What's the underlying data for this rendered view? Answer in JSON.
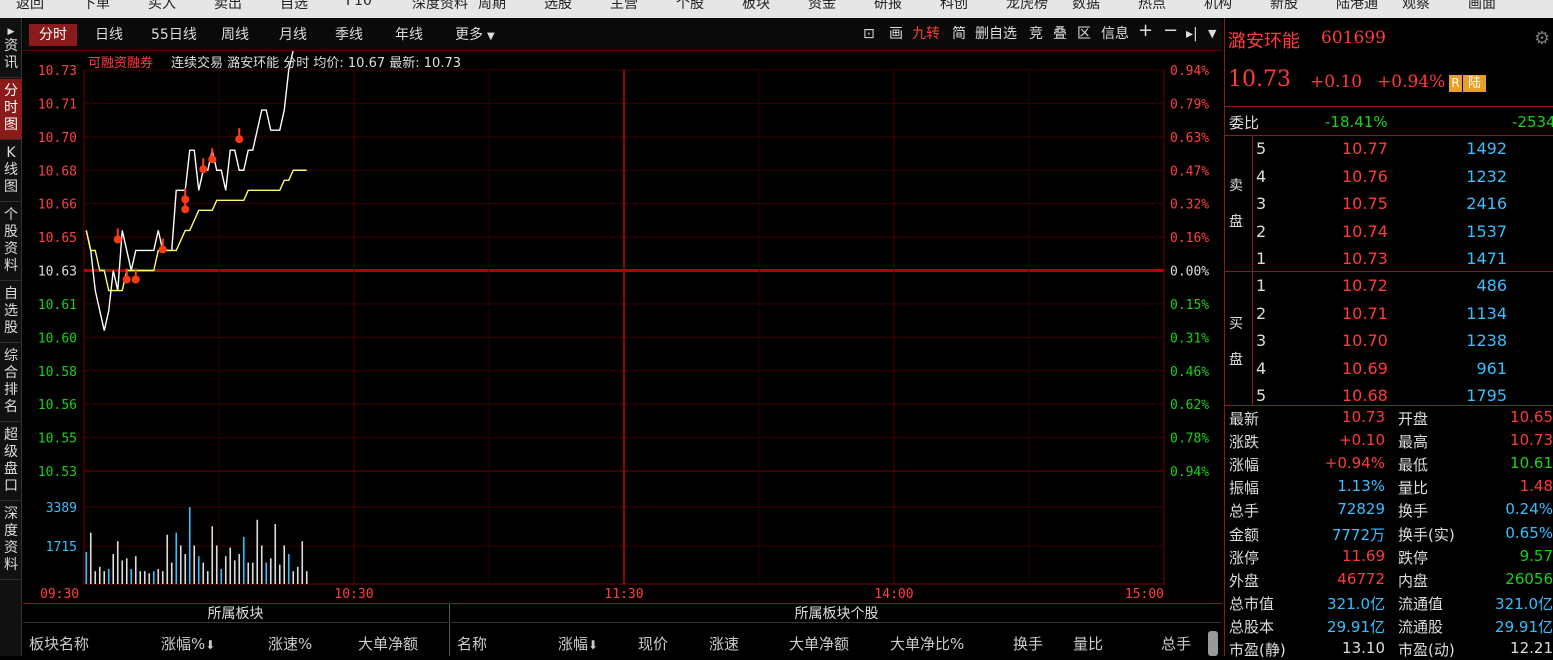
{
  "top_menu": [
    "返回",
    "下单",
    "买入",
    "卖出",
    "自选",
    "F10",
    "深度资料",
    "周期",
    "选股",
    "主营",
    "个股",
    "板块",
    "资金",
    "研报",
    "科创",
    "龙虎榜",
    "数据",
    "热点",
    "机构",
    "新股",
    "陆港通",
    "观察",
    "画面"
  ],
  "sidebar": [
    {
      "label": "资讯",
      "icon": "triangle-right-icon"
    },
    {
      "label": "分时图",
      "active": true
    },
    {
      "label": "K线图"
    },
    {
      "label": "个股资料"
    },
    {
      "label": "自选股"
    },
    {
      "label": "综合排名"
    },
    {
      "label": "超级盘口"
    },
    {
      "label": "深度资料"
    }
  ],
  "period_tabs": [
    "分时",
    "日线",
    "55日线",
    "周线",
    "月线",
    "季线",
    "年线",
    "更多"
  ],
  "tools": {
    "draw": "画",
    "jiuzhuan": "九转",
    "simple": "简",
    "del_watch": "删自选",
    "compete": "竞",
    "overlay": "叠",
    "zone": "区",
    "info": "信息"
  },
  "chart_header": {
    "margin_tag": "可融资融券",
    "text": "连续交易 潞安环能 分时 均价: 10.67 最新: 10.73"
  },
  "chart_data": {
    "type": "line",
    "x": [
      "09:30",
      "09:31",
      "09:32",
      "09:33",
      "09:34",
      "09:35",
      "09:36",
      "09:37",
      "09:38",
      "09:39",
      "09:40",
      "09:41",
      "09:42",
      "09:43",
      "09:44",
      "09:45",
      "09:46",
      "09:47",
      "09:48",
      "09:49",
      "09:50",
      "09:51",
      "09:52",
      "09:53",
      "09:54",
      "09:55",
      "09:56",
      "09:57",
      "09:58",
      "09:59",
      "10:00",
      "10:01",
      "10:02",
      "10:03",
      "10:04",
      "10:05",
      "10:06",
      "10:07",
      "10:08",
      "10:09",
      "10:10",
      "10:11",
      "10:12",
      "10:13",
      "10:14",
      "10:15",
      "10:16",
      "10:17",
      "10:18",
      "10:19",
      "10:20",
      "10:21",
      "10:22",
      "10:23",
      "10:24",
      "10:25",
      "10:26",
      "10:27",
      "10:28",
      "10:29",
      "10:30",
      "10:31"
    ],
    "series": [
      {
        "name": "分时",
        "color": "#ffffff",
        "values": [
          10.65,
          10.64,
          10.62,
          10.61,
          10.6,
          10.61,
          10.63,
          10.62,
          10.65,
          10.64,
          10.63,
          10.64,
          10.64,
          10.64,
          10.64,
          10.64,
          10.65,
          10.64,
          10.64,
          10.64,
          10.67,
          10.67,
          10.67,
          10.69,
          10.69,
          10.67,
          10.68,
          10.68,
          10.69,
          10.68,
          10.68,
          10.67,
          10.69,
          10.69,
          10.68,
          10.68,
          10.69,
          10.69,
          10.7,
          10.71,
          10.71,
          10.7,
          10.7,
          10.7,
          10.71,
          10.73,
          10.74,
          10.75,
          10.75,
          10.75
        ]
      },
      {
        "name": "均价",
        "color": "#ffff66",
        "values": [
          10.65,
          10.64,
          10.64,
          10.63,
          10.63,
          10.62,
          10.62,
          10.62,
          10.62,
          10.63,
          10.63,
          10.63,
          10.63,
          10.63,
          10.63,
          10.63,
          10.64,
          10.64,
          10.64,
          10.64,
          10.64,
          10.645,
          10.65,
          10.65,
          10.655,
          10.66,
          10.66,
          10.66,
          10.66,
          10.665,
          10.665,
          10.665,
          10.665,
          10.665,
          10.665,
          10.665,
          10.67,
          10.67,
          10.67,
          10.67,
          10.67,
          10.67,
          10.67,
          10.67,
          10.675,
          10.675,
          10.68,
          10.68,
          10.68,
          10.68
        ]
      }
    ],
    "volume": [
      1500,
      2400,
      600,
      800,
      600,
      700,
      1400,
      2000,
      1100,
      1200,
      700,
      1300,
      600,
      600,
      500,
      600,
      700,
      600,
      2300,
      1000,
      2400,
      1800,
      1400,
      3600,
      1800,
      1300,
      1000,
      600,
      2700,
      1800,
      700,
      1300,
      1700,
      1100,
      1400,
      2200,
      1000,
      1000,
      3000,
      1800,
      1000,
      1200,
      2800,
      900,
      1800,
      1400,
      600,
      800,
      2000,
      600
    ],
    "buy_markers": [
      [
        "09:37",
        10.65
      ],
      [
        "09:39",
        10.63
      ],
      [
        "09:41",
        10.63
      ],
      [
        "09:47",
        10.645
      ],
      [
        "09:52",
        10.665
      ],
      [
        "09:52",
        10.67
      ],
      [
        "09:56",
        10.685
      ],
      [
        "09:58",
        10.69
      ],
      [
        "10:04",
        10.7
      ]
    ],
    "price_ticks": [
      "10.73",
      "10.71",
      "10.70",
      "10.68",
      "10.66",
      "10.65",
      "10.63",
      "10.61",
      "10.60",
      "10.58",
      "10.56",
      "10.55",
      "10.53"
    ],
    "pct_ticks": [
      "0.94%",
      "0.79%",
      "0.63%",
      "0.47%",
      "0.32%",
      "0.16%",
      "0.00%",
      "0.15%",
      "0.31%",
      "0.46%",
      "0.62%",
      "0.78%",
      "0.94%"
    ],
    "vol_ticks": [
      "3389",
      "1715"
    ],
    "time_ticks": [
      "09:30",
      "10:30",
      "11:30",
      "14:00",
      "15:00"
    ],
    "ylim": [
      10.53,
      10.73
    ],
    "prev_close": 10.63,
    "vol_max": 5000
  },
  "sector_panel": {
    "left_title": "所属板块",
    "right_title": "所属板块个股",
    "left_cols": [
      "板块名称",
      "涨幅%",
      "涨速%",
      "大单净额"
    ],
    "right_cols": [
      "名称",
      "涨幅",
      "现价",
      "涨速",
      "大单净额",
      "大单净比%",
      "换手",
      "量比",
      "总手"
    ]
  },
  "quote": {
    "name": "潞安环能",
    "code": "601699",
    "price": "10.73",
    "change": "+0.10",
    "pct": "+0.94%",
    "badge_r": "R",
    "badge_lu": "陆",
    "weibi_label": "委比",
    "weibi": "-18.41%",
    "weicha": "-2534",
    "sell_label": [
      "卖",
      "盘"
    ],
    "sell": [
      [
        "5",
        "10.77",
        "1492"
      ],
      [
        "4",
        "10.76",
        "1232"
      ],
      [
        "3",
        "10.75",
        "2416"
      ],
      [
        "2",
        "10.74",
        "1537"
      ],
      [
        "1",
        "10.73",
        "1471"
      ]
    ],
    "buy_label": [
      "买",
      "盘"
    ],
    "buy": [
      [
        "1",
        "10.72",
        "486"
      ],
      [
        "2",
        "10.71",
        "1134"
      ],
      [
        "3",
        "10.70",
        "1238"
      ],
      [
        "4",
        "10.69",
        "961"
      ],
      [
        "5",
        "10.68",
        "1795"
      ]
    ],
    "stats": [
      [
        "最新",
        "10.73",
        "red",
        "开盘",
        "10.65",
        "red"
      ],
      [
        "涨跌",
        "+0.10",
        "red",
        "最高",
        "10.73",
        "red"
      ],
      [
        "涨幅",
        "+0.94%",
        "red",
        "最低",
        "10.61",
        "green"
      ],
      [
        "振幅",
        "1.13%",
        "cyan",
        "量比",
        "1.48",
        "red"
      ],
      [
        "总手",
        "72829",
        "cyan",
        "换手",
        "0.24%",
        "cyan"
      ],
      [
        "金额",
        "7772万",
        "cyan",
        "换手(实)",
        "0.65%",
        "cyan"
      ],
      [
        "涨停",
        "11.69",
        "red",
        "跌停",
        "9.57",
        "green"
      ],
      [
        "外盘",
        "46772",
        "red",
        "内盘",
        "26056",
        "green"
      ],
      [
        "总市值",
        "321.0亿",
        "cyan",
        "流通值",
        "321.0亿",
        "cyan"
      ],
      [
        "总股本",
        "29.91亿",
        "cyan",
        "流通股",
        "29.91亿",
        "cyan"
      ],
      [
        "市盈(静)",
        "13.10",
        "white",
        "市盈(动)",
        "12.21",
        "white"
      ]
    ]
  }
}
